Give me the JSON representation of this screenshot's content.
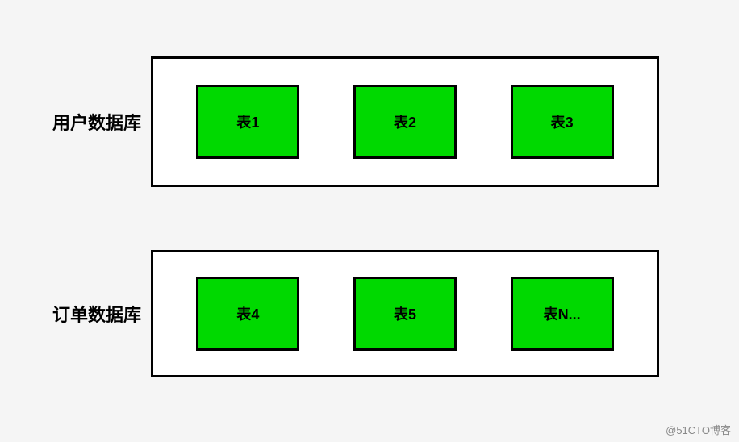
{
  "databases": [
    {
      "label": "用户数据库",
      "tables": [
        "表1",
        "表2",
        "表3"
      ]
    },
    {
      "label": "订单数据库",
      "tables": [
        "表4",
        "表5",
        "表N..."
      ]
    }
  ],
  "watermark": "@51CTO博客"
}
